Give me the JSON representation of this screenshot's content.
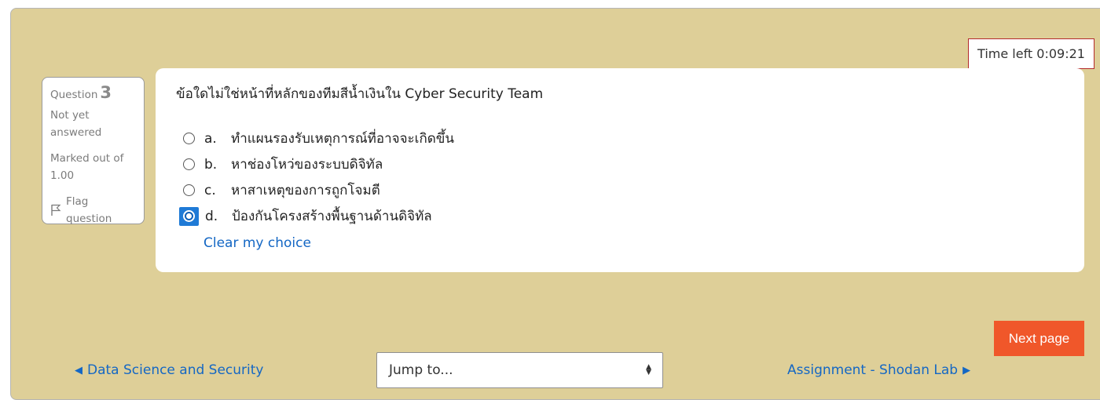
{
  "timer": {
    "label": "Time left 0:09:21"
  },
  "question_info": {
    "question_label": "Question",
    "question_number": "3",
    "state": "Not yet answered",
    "grade": "Marked out of 1.00",
    "flag_label": "Flag question"
  },
  "question": {
    "text": "ข้อใดไม่ใช่หน้าที่หลักของทีมสีน้ำเงินใน Cyber Security Team",
    "answers": [
      {
        "letter": "a.",
        "text": "ทำแผนรองรับเหตุการณ์ที่อาจจะเกิดขึ้น",
        "selected": false
      },
      {
        "letter": "b.",
        "text": "หาช่องโหว่ของระบบดิจิทัล",
        "selected": false
      },
      {
        "letter": "c.",
        "text": "หาสาเหตุของการถูกโจมตี",
        "selected": false
      },
      {
        "letter": "d.",
        "text": "ป้องกันโครงสร้างพื้นฐานด้านดิจิทัล",
        "selected": true
      }
    ],
    "clear_choice": "Clear my choice"
  },
  "navigation": {
    "next_page": "Next page",
    "prev_link": "Data Science and Security",
    "next_link": "Assignment - Shodan Lab",
    "jump_placeholder": "Jump to..."
  },
  "colors": {
    "page_background": "#decf98",
    "next_button": "#f0572a",
    "link": "#1467c4",
    "timer_border": "#b32a2a",
    "radio_selected": "#1f7ad6"
  }
}
